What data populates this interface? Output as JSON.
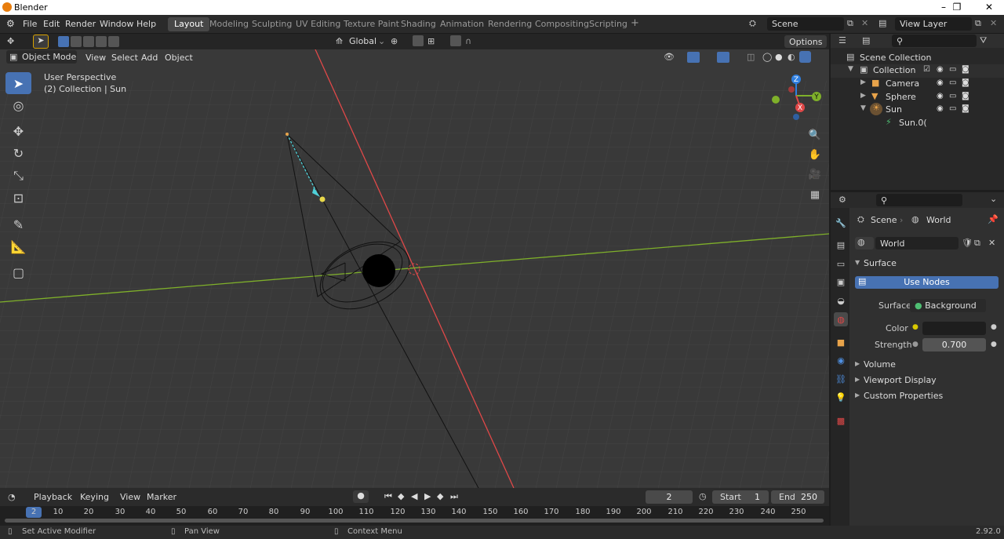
{
  "app": {
    "title": "Blender",
    "version": "2.92.0"
  },
  "menu": [
    "File",
    "Edit",
    "Render",
    "Window",
    "Help"
  ],
  "workspaces": [
    "Layout",
    "Modeling",
    "Sculpting",
    "UV Editing",
    "Texture Paint",
    "Shading",
    "Animation",
    "Rendering",
    "Compositing",
    "Scripting"
  ],
  "active_workspace": "Layout",
  "add_workspace": "+",
  "scene_field": "Scene",
  "view_layer_field": "View Layer",
  "toolbar": {
    "transform_orientation": "Global",
    "options": "Options"
  },
  "viewport_header": {
    "mode": "Object Mode",
    "menus": [
      "View",
      "Select",
      "Add",
      "Object"
    ]
  },
  "viewport": {
    "perspective": "User Perspective",
    "context": "(2) Collection | Sun"
  },
  "gizmo": {
    "z": "Z",
    "y": "Y",
    "x": "X"
  },
  "outliner": {
    "root": "Scene Collection",
    "items": [
      {
        "name": "Collection",
        "color": "#cccccc"
      },
      {
        "name": "Camera",
        "color": "#e8a34a"
      },
      {
        "name": "Sphere",
        "color": "#e8a34a"
      },
      {
        "name": "Sun",
        "color": "#e8a34a"
      },
      {
        "name": "Sun.0(",
        "color": "#4fbf73"
      }
    ]
  },
  "properties": {
    "breadcrumb_scene": "Scene",
    "breadcrumb_world": "World",
    "world_field": "World",
    "panels": {
      "surface": "Surface",
      "volume": "Volume",
      "viewport_display": "Viewport Display",
      "custom_properties": "Custom Properties"
    },
    "use_nodes": "Use Nodes",
    "surface_label": "Surface",
    "surface_value": "Background",
    "color_label": "Color",
    "strength_label": "Strength",
    "strength_value": "0.700"
  },
  "timeline": {
    "menus": [
      "Playback",
      "Keying",
      "View",
      "Marker"
    ],
    "current_frame": "2",
    "start_label": "Start",
    "start": "1",
    "end_label": "End",
    "end": "250",
    "ticks": [
      "2",
      "10",
      "20",
      "30",
      "40",
      "50",
      "60",
      "70",
      "80",
      "90",
      "100",
      "110",
      "120",
      "130",
      "140",
      "150",
      "160",
      "170",
      "180",
      "190",
      "200",
      "210",
      "220",
      "230",
      "240",
      "250"
    ]
  },
  "status": {
    "left": "Set Active Modifier",
    "middle": "Pan View",
    "right": "Context Menu"
  },
  "colors": {
    "accent": "#4772b3",
    "x_axis": "#e04848",
    "y_axis": "#7fb02a",
    "z_axis": "#2f7fe0",
    "sun": "#e8d84a"
  }
}
